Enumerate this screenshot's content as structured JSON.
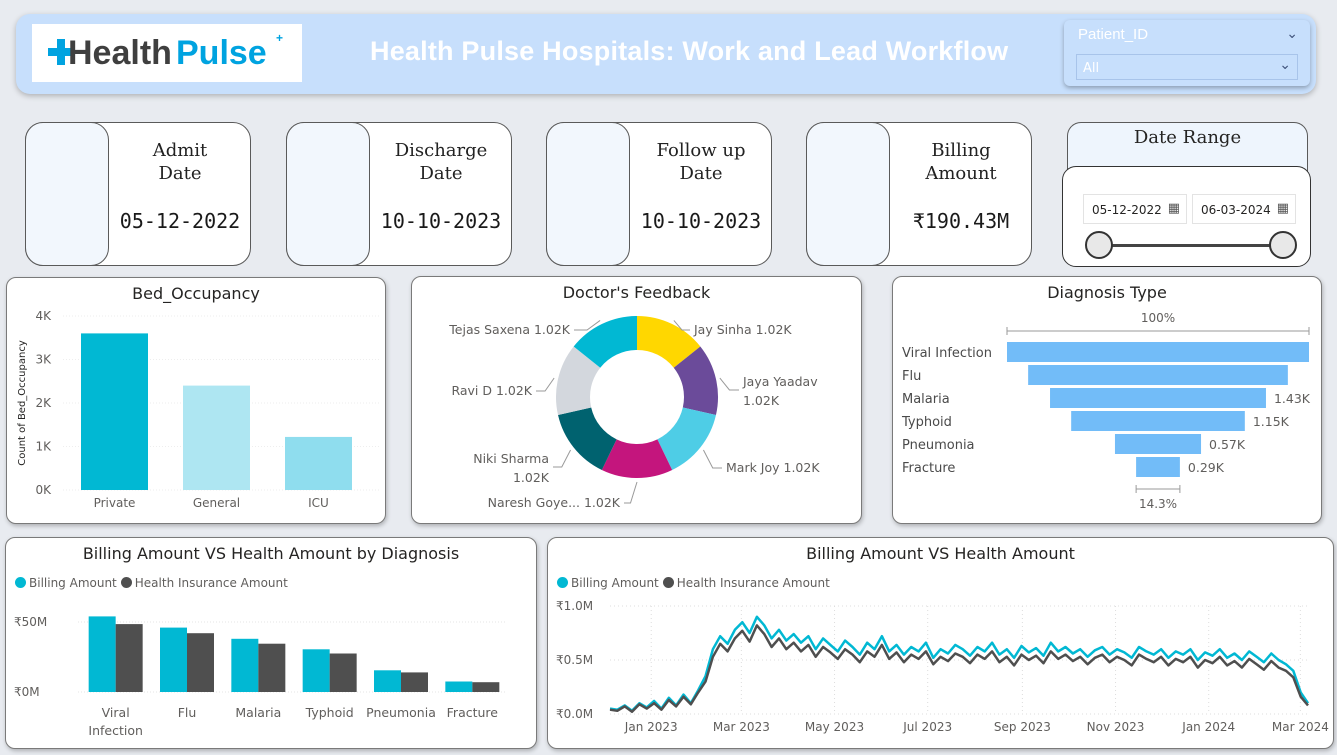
{
  "header": {
    "logo_text_a": "Health",
    "logo_text_b": "Pulse",
    "title": "Health Pulse Hospitals: Work and Lead Workflow",
    "slicer_label": "Patient_ID",
    "slicer_value": "All"
  },
  "kpis": [
    {
      "label_line1": "Admit",
      "label_line2": "Date",
      "value": "05-12-2022"
    },
    {
      "label_line1": "Discharge",
      "label_line2": "Date",
      "value": "10-10-2023"
    },
    {
      "label_line1": "Follow up",
      "label_line2": "Date",
      "value": "10-10-2023"
    },
    {
      "label_line1": "Billing",
      "label_line2": "Amount",
      "value": "₹190.43M"
    }
  ],
  "date_range": {
    "title": "Date Range",
    "start": "05-12-2022",
    "end": "06-03-2024",
    "start_fraction": 0,
    "end_fraction": 1
  },
  "colors": {
    "teal": "#01B8D3",
    "dark": "#4F4F4F",
    "funnel": "#72BCF8",
    "accent_header": "#C7DFFC"
  },
  "chart_data": [
    {
      "id": "bed",
      "type": "bar",
      "title": "Bed_Occupancy",
      "ylabel": "Count of Bed_Occupancy",
      "categories": [
        "Private",
        "General",
        "ICU"
      ],
      "values": [
        3600,
        2400,
        1220
      ],
      "colors": [
        "#01B8D3",
        "#AEE6F2",
        "#8FDDEE"
      ],
      "ylim": [
        0,
        4000
      ],
      "yticks": [
        0,
        1000,
        2000,
        3000,
        4000
      ],
      "ytick_labels": [
        "0K",
        "1K",
        "2K",
        "3K",
        "4K"
      ],
      "grid": true
    },
    {
      "id": "feedback",
      "type": "pie",
      "title": "Doctor's Feedback",
      "slices": [
        {
          "label": "Jay Sinha",
          "value_label": "1.02K",
          "value": 1.02,
          "color": "#FFD700"
        },
        {
          "label": "Jaya Yaadav",
          "value_label": "1.02K",
          "value": 1.02,
          "color": "#6B4B9A"
        },
        {
          "label": "Mark Joy",
          "value_label": "1.02K",
          "value": 1.02,
          "color": "#4ECDE6"
        },
        {
          "label": "Naresh Goye...",
          "value_label": "1.02K",
          "value": 1.02,
          "color": "#C4157D"
        },
        {
          "label": "Niki Sharma",
          "value_label": "1.02K",
          "value": 1.02,
          "color": "#00626F"
        },
        {
          "label": "Ravi D",
          "value_label": "1.02K",
          "value": 1.02,
          "color": "#D3D7DD"
        },
        {
          "label": "Tejas Saxena",
          "value_label": "1.02K",
          "value": 1.02,
          "color": "#01B8D3"
        }
      ]
    },
    {
      "id": "diagnosis",
      "type": "bar",
      "orientation": "funnel",
      "title": "Diagnosis Type",
      "categories": [
        "Viral Infection",
        "Flu",
        "Malaria",
        "Typhoid",
        "Pneumonia",
        "Fracture"
      ],
      "values": [
        2.0,
        1.72,
        1.43,
        1.15,
        0.57,
        0.29
      ],
      "value_labels": [
        "",
        "",
        "1.43K",
        "1.15K",
        "0.57K",
        "0.29K"
      ],
      "top_label": "100%",
      "bottom_label": "14.3%"
    },
    {
      "id": "billing_diag",
      "type": "bar",
      "title": "Billing Amount VS Health Amount by Diagnosis",
      "categories": [
        "Viral Infection",
        "Flu",
        "Malaria",
        "Typhoid",
        "Pneumonia",
        "Fracture"
      ],
      "series": [
        {
          "name": "Billing Amount",
          "color": "#01B8D3",
          "values": [
            54,
            46,
            38,
            30.5,
            15.5,
            7.5
          ]
        },
        {
          "name": "Health Insurance Amount",
          "color": "#4F4F4F",
          "values": [
            48.5,
            42,
            34.5,
            27.5,
            14,
            7
          ]
        }
      ],
      "ylim": [
        0,
        60
      ],
      "yticks": [
        0,
        50
      ],
      "ytick_labels": [
        "₹0M",
        "₹50M"
      ]
    },
    {
      "id": "billing_time",
      "type": "line",
      "title": "Billing Amount VS Health Amount",
      "x_range": [
        "2022-12-05",
        "2024-03-06"
      ],
      "xtick_labels": [
        "Jan 2023",
        "Mar 2023",
        "May 2023",
        "Jul 2023",
        "Sep 2023",
        "Nov 2023",
        "Jan 2024",
        "Mar 2024"
      ],
      "xticks": [
        "2023-01-01",
        "2023-03-01",
        "2023-05-01",
        "2023-07-01",
        "2023-09-01",
        "2023-11-01",
        "2024-01-01",
        "2024-03-01"
      ],
      "ylim": [
        0,
        1.0
      ],
      "yticks": [
        0,
        0.5,
        1.0
      ],
      "ytick_labels": [
        "₹0.0M",
        "₹0.5M",
        "₹1.0M"
      ],
      "grid": true,
      "series": [
        {
          "name": "Billing Amount",
          "color": "#01B8D3",
          "values": [
            0.05,
            0.04,
            0.08,
            0.03,
            0.1,
            0.06,
            0.12,
            0.05,
            0.15,
            0.08,
            0.18,
            0.1,
            0.22,
            0.35,
            0.6,
            0.72,
            0.65,
            0.78,
            0.85,
            0.75,
            0.9,
            0.82,
            0.7,
            0.78,
            0.68,
            0.74,
            0.66,
            0.72,
            0.6,
            0.7,
            0.64,
            0.58,
            0.68,
            0.62,
            0.55,
            0.66,
            0.6,
            0.72,
            0.58,
            0.64,
            0.55,
            0.62,
            0.58,
            0.66,
            0.52,
            0.6,
            0.56,
            0.64,
            0.6,
            0.54,
            0.62,
            0.58,
            0.66,
            0.55,
            0.6,
            0.52,
            0.63,
            0.57,
            0.61,
            0.54,
            0.66,
            0.58,
            0.62,
            0.56,
            0.6,
            0.53,
            0.59,
            0.62,
            0.55,
            0.6,
            0.57,
            0.52,
            0.62,
            0.58,
            0.55,
            0.6,
            0.52,
            0.58,
            0.55,
            0.6,
            0.5,
            0.57,
            0.54,
            0.6,
            0.52,
            0.56,
            0.5,
            0.58,
            0.53,
            0.48,
            0.56,
            0.5,
            0.46,
            0.4,
            0.2,
            0.1
          ]
        },
        {
          "name": "Health Insurance Amount",
          "color": "#4F4F4F",
          "values": [
            0.04,
            0.03,
            0.07,
            0.02,
            0.09,
            0.05,
            0.1,
            0.04,
            0.13,
            0.07,
            0.16,
            0.09,
            0.2,
            0.3,
            0.53,
            0.65,
            0.58,
            0.7,
            0.77,
            0.67,
            0.82,
            0.74,
            0.62,
            0.7,
            0.6,
            0.66,
            0.58,
            0.64,
            0.53,
            0.62,
            0.57,
            0.51,
            0.6,
            0.55,
            0.48,
            0.58,
            0.53,
            0.64,
            0.51,
            0.57,
            0.48,
            0.55,
            0.51,
            0.58,
            0.46,
            0.53,
            0.49,
            0.56,
            0.53,
            0.47,
            0.55,
            0.51,
            0.58,
            0.48,
            0.53,
            0.45,
            0.55,
            0.5,
            0.54,
            0.47,
            0.58,
            0.51,
            0.55,
            0.49,
            0.53,
            0.46,
            0.52,
            0.55,
            0.48,
            0.53,
            0.5,
            0.45,
            0.55,
            0.51,
            0.48,
            0.53,
            0.45,
            0.51,
            0.48,
            0.53,
            0.43,
            0.5,
            0.47,
            0.53,
            0.45,
            0.49,
            0.43,
            0.51,
            0.46,
            0.41,
            0.49,
            0.43,
            0.4,
            0.34,
            0.16,
            0.08
          ]
        }
      ]
    }
  ]
}
